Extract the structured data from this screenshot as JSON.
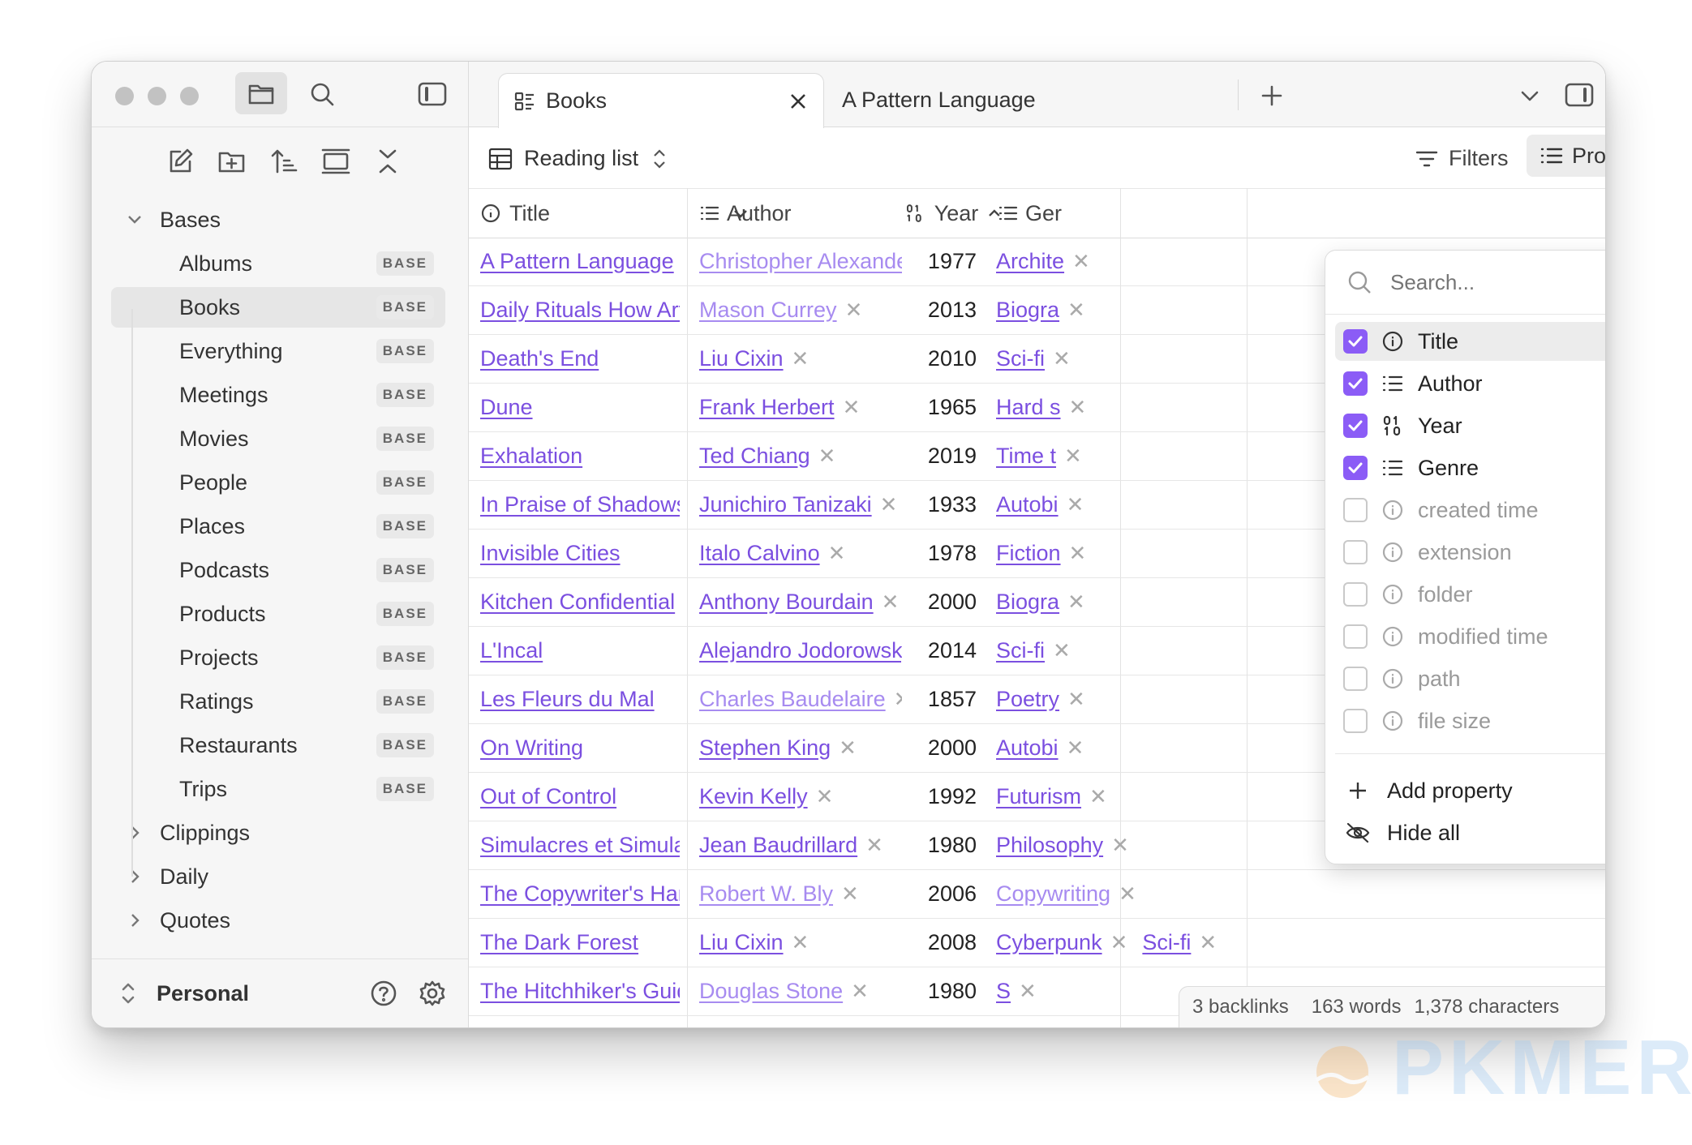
{
  "sidebar": {
    "folders": [
      {
        "label": "Bases",
        "expanded": true
      },
      {
        "label": "Clippings",
        "expanded": false
      },
      {
        "label": "Daily",
        "expanded": false
      },
      {
        "label": "Quotes",
        "expanded": false
      }
    ],
    "bases": [
      {
        "label": "Albums",
        "badge": "BASE"
      },
      {
        "label": "Books",
        "badge": "BASE",
        "selected": true
      },
      {
        "label": "Everything",
        "badge": "BASE"
      },
      {
        "label": "Meetings",
        "badge": "BASE"
      },
      {
        "label": "Movies",
        "badge": "BASE"
      },
      {
        "label": "People",
        "badge": "BASE"
      },
      {
        "label": "Places",
        "badge": "BASE"
      },
      {
        "label": "Podcasts",
        "badge": "BASE"
      },
      {
        "label": "Products",
        "badge": "BASE"
      },
      {
        "label": "Projects",
        "badge": "BASE"
      },
      {
        "label": "Ratings",
        "badge": "BASE"
      },
      {
        "label": "Restaurants",
        "badge": "BASE"
      },
      {
        "label": "Trips",
        "badge": "BASE"
      }
    ],
    "vault_name": "Personal"
  },
  "tabs": [
    {
      "label": "Books",
      "active": true
    },
    {
      "label": "A Pattern Language",
      "active": false
    }
  ],
  "viewbar": {
    "view_name": "Reading list",
    "filters_label": "Filters",
    "properties_label": "Properties"
  },
  "table": {
    "columns": [
      "Title",
      "Author",
      "Year",
      "Ger"
    ],
    "rows": [
      {
        "title": "A Pattern Language",
        "author": "Christopher Alexander",
        "author_faded": true,
        "year": "1977",
        "genre": "Archite"
      },
      {
        "title": "Daily Rituals How Artists ...",
        "author": "Mason Currey",
        "author_faded": true,
        "year": "2013",
        "genre": "Biogra"
      },
      {
        "title": "Death's End",
        "author": "Liu Cixin",
        "author_faded": false,
        "year": "2010",
        "genre": "Sci-fi"
      },
      {
        "title": "Dune",
        "author": "Frank Herbert",
        "author_faded": false,
        "year": "1965",
        "genre": "Hard s"
      },
      {
        "title": "Exhalation",
        "author": "Ted Chiang",
        "author_faded": false,
        "year": "2019",
        "genre": "Time t"
      },
      {
        "title": "In Praise of Shadows",
        "author": "Junichiro Tanizaki",
        "author_faded": false,
        "year": "1933",
        "genre": "Autobi"
      },
      {
        "title": "Invisible Cities",
        "author": "Italo Calvino",
        "author_faded": false,
        "year": "1978",
        "genre": "Fiction"
      },
      {
        "title": "Kitchen Confidential",
        "author": "Anthony Bourdain",
        "author_faded": false,
        "year": "2000",
        "genre": "Biogra"
      },
      {
        "title": "L'Incal",
        "author": "Alejandro Jodorowsky",
        "author_faded": false,
        "year": "2014",
        "genre": "Sci-fi"
      },
      {
        "title": "Les Fleurs du Mal",
        "author": "Charles Baudelaire",
        "author_faded": true,
        "year": "1857",
        "genre": "Poetry"
      },
      {
        "title": "On Writing",
        "author": "Stephen King",
        "author_faded": false,
        "year": "2000",
        "genre": "Autobi"
      },
      {
        "title": "Out of Control",
        "author": "Kevin Kelly",
        "author_faded": false,
        "year": "1992",
        "genre": "Futurism"
      },
      {
        "title": "Simulacres et Simulation",
        "author": "Jean Baudrillard",
        "author_faded": false,
        "year": "1980",
        "genre": "Philosophy"
      },
      {
        "title": "The Copywriter's Handb...",
        "author": "Robert W. Bly",
        "author_faded": true,
        "year": "2006",
        "genre": "Copywriting",
        "genre_faded": true
      },
      {
        "title": "The Dark Forest",
        "author": "Liu Cixin",
        "author_faded": false,
        "year": "2008",
        "genre": "Cyberpunk",
        "genre2": "Sci-fi"
      },
      {
        "title": "The Hitchhiker's Guide t...",
        "author": "Douglas Stone",
        "author_faded": true,
        "year": "1980",
        "genre": "S"
      }
    ]
  },
  "properties_menu": {
    "search_placeholder": "Search...",
    "items": [
      {
        "label": "Title",
        "checked": true,
        "icon": "info-icon"
      },
      {
        "label": "Author",
        "checked": true,
        "icon": "list-icon"
      },
      {
        "label": "Year",
        "checked": true,
        "icon": "number-icon"
      },
      {
        "label": "Genre",
        "checked": true,
        "icon": "list-icon"
      },
      {
        "label": "created time",
        "checked": false,
        "icon": "info-icon"
      },
      {
        "label": "extension",
        "checked": false,
        "icon": "info-icon"
      },
      {
        "label": "folder",
        "checked": false,
        "icon": "info-icon"
      },
      {
        "label": "modified time",
        "checked": false,
        "icon": "info-icon"
      },
      {
        "label": "path",
        "checked": false,
        "icon": "info-icon"
      },
      {
        "label": "file size",
        "checked": false,
        "icon": "info-icon"
      }
    ],
    "add_property_label": "Add property",
    "hide_all_label": "Hide all"
  },
  "statusbar": {
    "backlinks": "3 backlinks",
    "words": "163 words",
    "characters": "1,378 characters"
  },
  "watermark": {
    "text": "PKMER"
  },
  "colors": {
    "accent": "#8b5cf6",
    "link": "#7b4fe0"
  }
}
